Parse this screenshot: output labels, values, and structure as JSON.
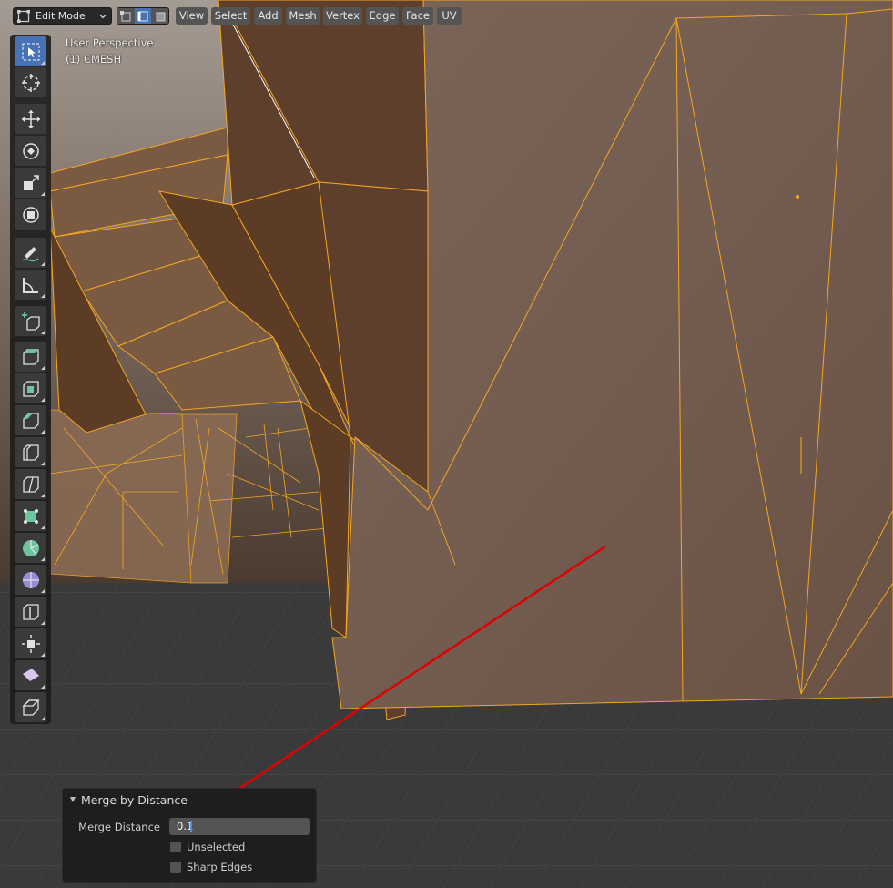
{
  "header": {
    "mode_label": "Edit Mode",
    "select_mode_buttons": [
      "vertex-select",
      "edge-select",
      "face-select"
    ],
    "active_select_mode": "edge-select",
    "menus": [
      "View",
      "Select",
      "Add",
      "Mesh",
      "Vertex",
      "Edge",
      "Face",
      "UV"
    ]
  },
  "viewport": {
    "perspective_label": "User Perspective",
    "object_label": "(1) CMESH"
  },
  "toolbar": {
    "active_tool": "select-box",
    "tools": [
      "select-box",
      "cursor",
      "move",
      "rotate",
      "scale",
      "transform",
      "annotate",
      "measure",
      "add-cube",
      "extrude-region",
      "inset-faces",
      "bevel",
      "loop-cut",
      "knife",
      "poly-build",
      "spin",
      "smooth",
      "edge-slide",
      "shrink-fatten",
      "shear",
      "rip-region"
    ]
  },
  "redo_panel": {
    "title": "Merge by Distance",
    "merge_distance_label": "Merge Distance",
    "merge_distance_value": "0.1",
    "unselected_label": "Unselected",
    "unselected_checked": false,
    "sharp_edges_label": "Sharp Edges",
    "sharp_edges_checked": false
  },
  "colors": {
    "accent": "#4772b3",
    "wire_selected": "#f5a623",
    "annotation_arrow": "#e00000"
  }
}
